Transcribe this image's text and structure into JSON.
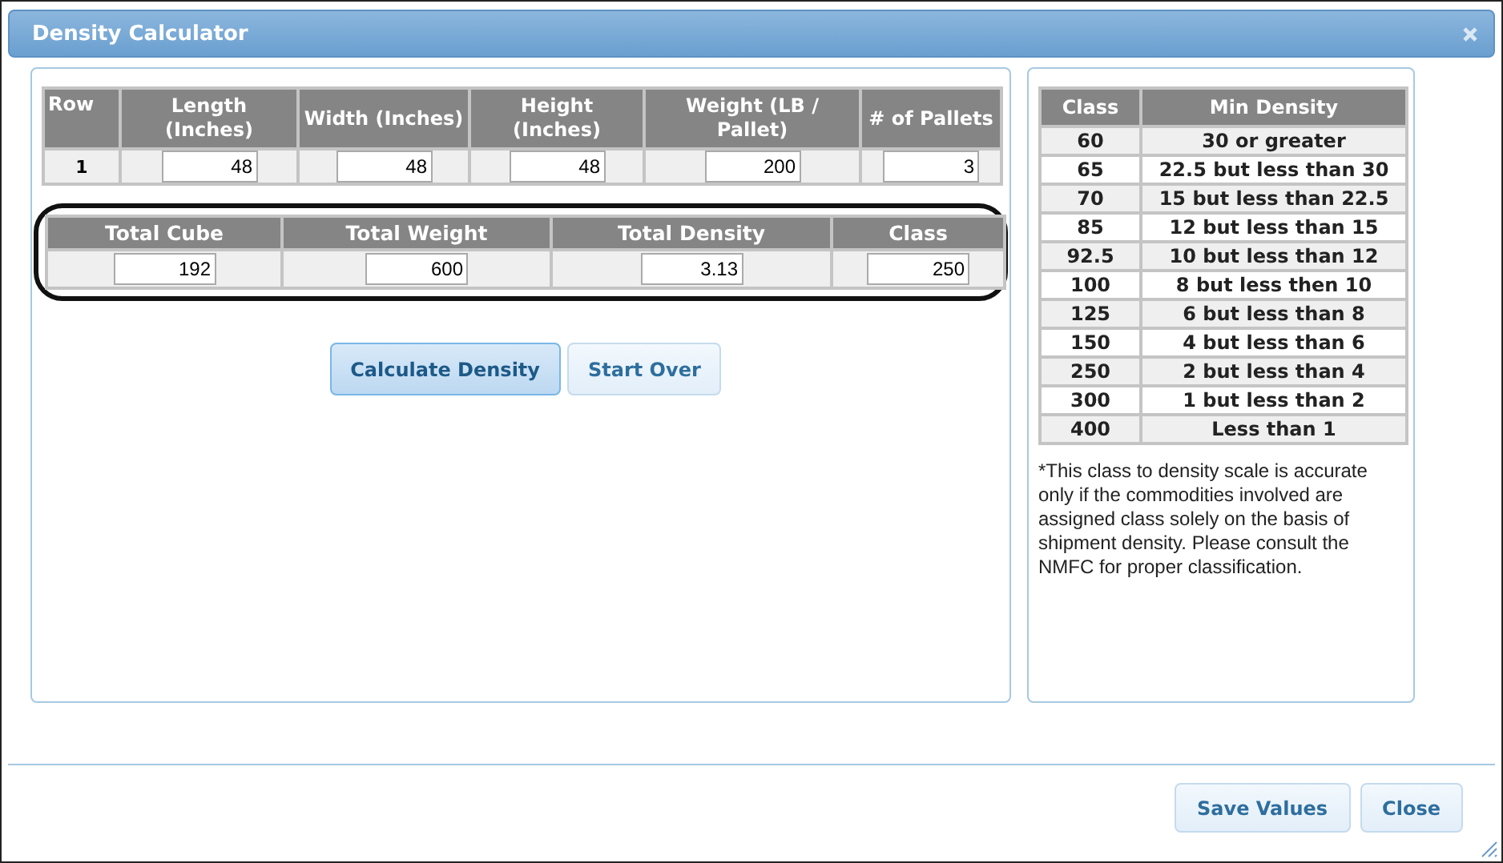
{
  "window": {
    "title": "Density Calculator"
  },
  "dimensions_table": {
    "columns": [
      "Row",
      "Length (Inches)",
      "Width (Inches)",
      "Height (Inches)",
      "Weight (LB / Pallet)",
      "# of Pallets"
    ],
    "rows": [
      {
        "row": "1",
        "values": [
          "48",
          "48",
          "48",
          "200",
          "3"
        ]
      }
    ]
  },
  "totals_table": {
    "columns": [
      "Total Cube",
      "Total Weight",
      "Total Density",
      "Class"
    ],
    "values": [
      "192",
      "600",
      "3.13",
      "250"
    ]
  },
  "actions": [
    {
      "label": "Calculate Density",
      "focused": true
    },
    {
      "label": "Start Over",
      "focused": false
    }
  ],
  "class_table": {
    "columns": [
      "Class",
      "Min Density"
    ],
    "rows": [
      [
        "60",
        "30 or greater"
      ],
      [
        "65",
        "22.5 but less than 30"
      ],
      [
        "70",
        "15 but less than 22.5"
      ],
      [
        "85",
        "12 but less than 15"
      ],
      [
        "92.5",
        "10 but less than 12"
      ],
      [
        "100",
        "8 but less then 10"
      ],
      [
        "125",
        "6 but less than 8"
      ],
      [
        "150",
        "4 but less than 6"
      ],
      [
        "250",
        "2 but less than 4"
      ],
      [
        "300",
        "1 but less than 2"
      ],
      [
        "400",
        "Less than 1"
      ]
    ]
  },
  "note": "*This class to density scale is accurate only if the commodities involved are assigned class solely on the basis of shipment density. Please consult the NMFC for proper classification.",
  "footer_buttons": [
    "Save Values",
    "Close"
  ]
}
